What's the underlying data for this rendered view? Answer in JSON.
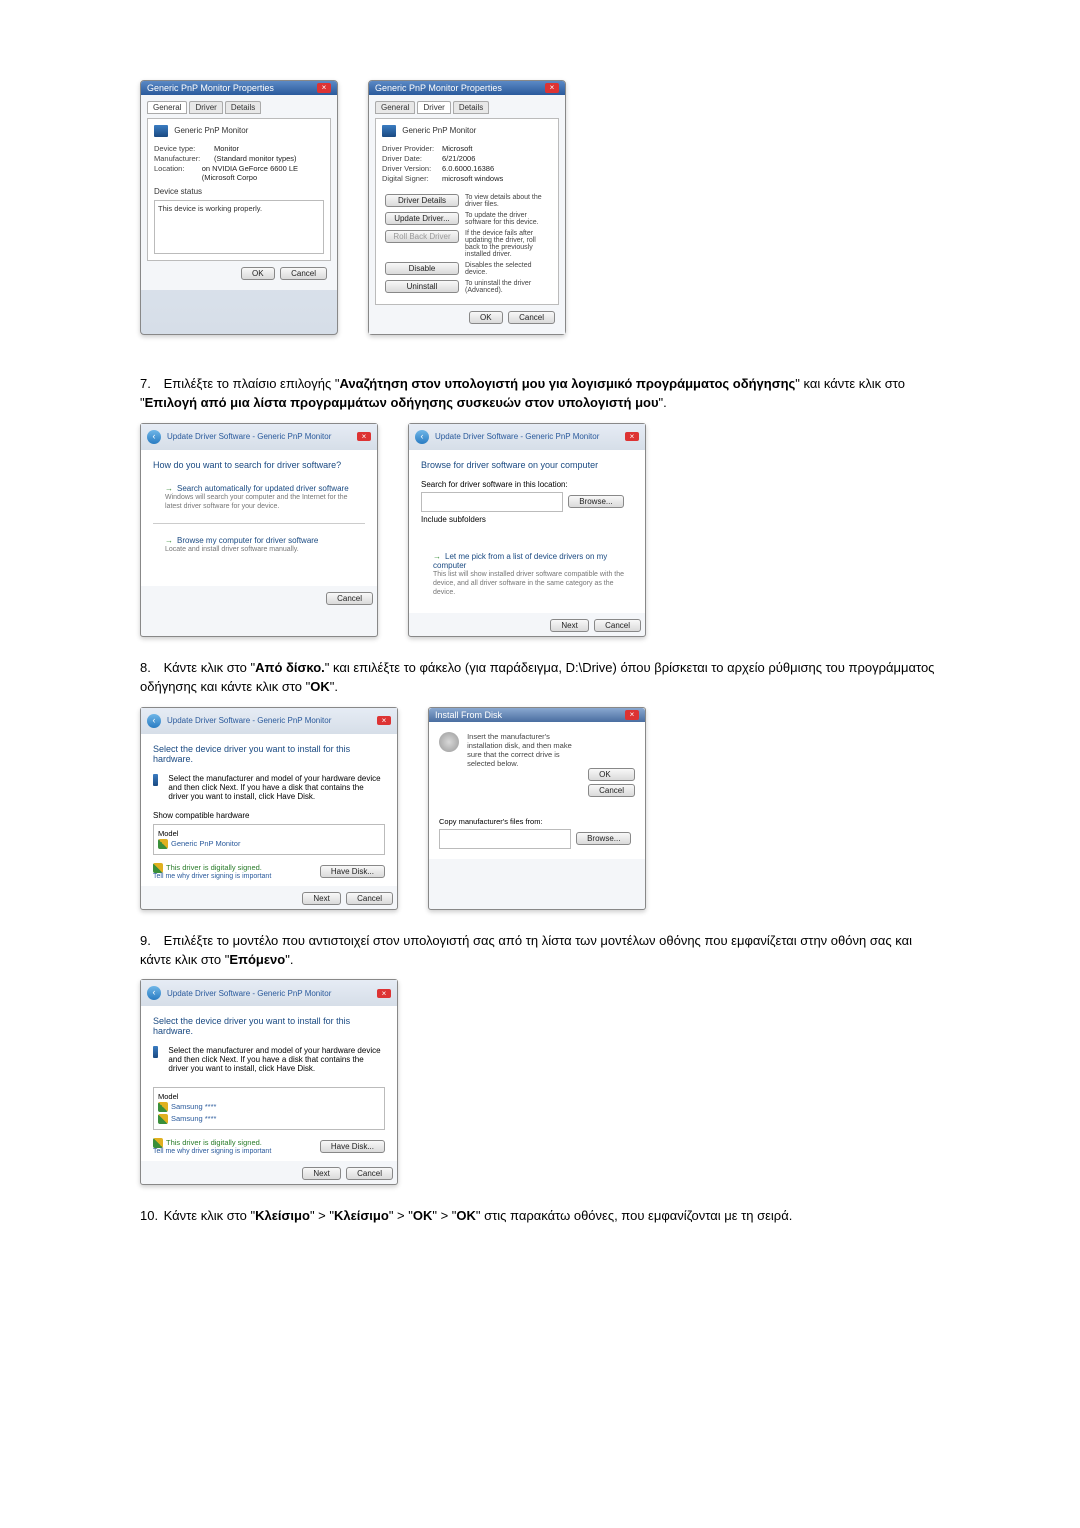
{
  "step7": {
    "num": "7.",
    "prefix": "Επιλέξτε το πλαίσιο επιλογής \"",
    "bold1": "Αναζήτηση στον υπολογιστή μου για λογισμικό προγράμματος οδήγησης",
    "mid": "\" και κάντε κλικ στο \"",
    "bold2": "Επιλογή από μια λίστα προγραμμάτων οδήγησης συσκευών στον υπολογιστή μου",
    "suffix": "\"."
  },
  "step8": {
    "num": "8.",
    "prefix": "Κάντε κλικ στο \"",
    "bold1": "Από δίσκο.",
    "mid": "\" και επιλέξτε το φάκελο (για παράδειγμα, D:\\Drive) όπου βρίσκεται το αρχείο ρύθμισης του προγράμματος οδήγησης και κάντε κλικ στο \"",
    "bold2": "OK",
    "suffix": "\"."
  },
  "step9": {
    "num": "9.",
    "prefix": "Επιλέξτε το μοντέλο που αντιστοιχεί στον υπολογιστή σας από τη λίστα των μοντέλων οθόνης που εμφανίζεται στην οθόνη σας και κάντε κλικ στο \"",
    "bold1": "Επόμενο",
    "suffix": "\"."
  },
  "step10": {
    "num": "10.",
    "prefix": "Κάντε κλικ στο \"",
    "b1": "Κλείσιμο",
    "s1": "\" > \"",
    "b2": "Κλείσιμο",
    "s2": "\" > \"",
    "b3": "OK",
    "s3": "\" > \"",
    "b4": "OK",
    "suffix": "\" στις παρακάτω οθόνες, που εμφανίζονται με τη σειρά."
  },
  "properties": {
    "title": "Generic PnP Monitor Properties",
    "tabGeneral": "General",
    "tabDriver": "Driver",
    "tabDetails": "Details",
    "heading": "Generic PnP Monitor",
    "deviceTypeK": "Device type:",
    "deviceTypeV": "Monitor",
    "manufacturerK": "Manufacturer:",
    "manufacturerV": "(Standard monitor types)",
    "locationK": "Location:",
    "locationV": "on NVIDIA GeForce 6600 LE (Microsoft Corpo",
    "deviceStatusLabel": "Device status",
    "deviceStatusText": "This device is working properly.",
    "ok": "OK",
    "cancel": "Cancel"
  },
  "properties2": {
    "heading": "Generic PnP Monitor",
    "providerK": "Driver Provider:",
    "providerV": "Microsoft",
    "dateK": "Driver Date:",
    "dateV": "6/21/2006",
    "versionK": "Driver Version:",
    "versionV": "6.0.6000.16386",
    "signerK": "Digital Signer:",
    "signerV": "microsoft windows",
    "btnDetails": "Driver Details",
    "descDetails": "To view details about the driver files.",
    "btnUpdate": "Update Driver...",
    "descUpdate": "To update the driver software for this device.",
    "btnRollback": "Roll Back Driver",
    "descRollback": "If the device fails after updating the driver, roll back to the previously installed driver.",
    "btnDisable": "Disable",
    "descDisable": "Disables the selected device.",
    "btnUninstall": "Uninstall",
    "descUninstall": "To uninstall the driver (Advanced)."
  },
  "wizard1": {
    "breadcrumb": "Update Driver Software - Generic PnP Monitor",
    "title": "How do you want to search for driver software?",
    "c1label": "Search automatically for updated driver software",
    "c1desc": "Windows will search your computer and the Internet for the latest driver software for your device.",
    "c2label": "Browse my computer for driver software",
    "c2desc": "Locate and install driver software manually.",
    "cancel": "Cancel"
  },
  "wizard2": {
    "breadcrumb": "Update Driver Software - Generic PnP Monitor",
    "title": "Browse for driver software on your computer",
    "searchLabel": "Search for driver software in this location:",
    "browse": "Browse...",
    "include": "Include subfolders",
    "pickLabel": "Let me pick from a list of device drivers on my computer",
    "pickDesc": "This list will show installed driver software compatible with the device, and all driver software in the same category as the device.",
    "next": "Next",
    "cancel": "Cancel"
  },
  "wizard3": {
    "breadcrumb": "Update Driver Software - Generic PnP Monitor",
    "title": "Select the device driver you want to install for this hardware.",
    "desc": "Select the manufacturer and model of your hardware device and then click Next. If you have a disk that contains the driver you want to install, click Have Disk.",
    "compat": "Show compatible hardware",
    "modelLabel": "Model",
    "model1": "Generic PnP Monitor",
    "signed": "This driver is digitally signed.",
    "signedLink": "Tell me why driver signing is important",
    "haveDisk": "Have Disk...",
    "next": "Next",
    "cancel": "Cancel"
  },
  "installDisk": {
    "title": "Install From Disk",
    "text": "Insert the manufacturer's installation disk, and then make sure that the correct drive is selected below.",
    "ok": "OK",
    "cancel": "Cancel",
    "copyLabel": "Copy manufacturer's files from:",
    "browse": "Browse..."
  },
  "wizard4": {
    "breadcrumb": "Update Driver Software - Generic PnP Monitor",
    "title": "Select the device driver you want to install for this hardware.",
    "desc": "Select the manufacturer and model of your hardware device and then click Next. If you have a disk that contains the driver you want to install, click Have Disk.",
    "modelLabel": "Model",
    "model1": "Samsung ****",
    "model2": "Samsung ****",
    "signed": "This driver is digitally signed.",
    "signedLink": "Tell me why driver signing is important",
    "haveDisk": "Have Disk...",
    "next": "Next",
    "cancel": "Cancel"
  }
}
